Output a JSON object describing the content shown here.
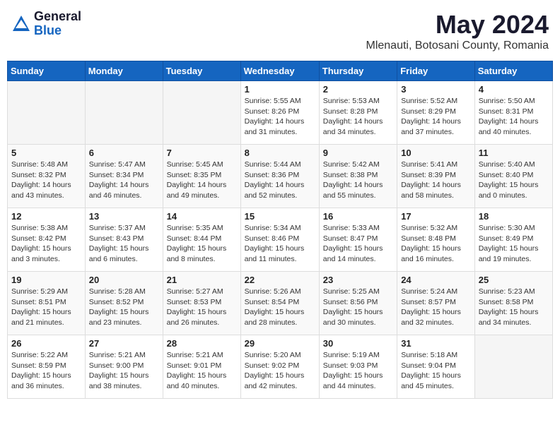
{
  "logo": {
    "general": "General",
    "blue": "Blue"
  },
  "header": {
    "month_year": "May 2024",
    "location": "Mlenauti, Botosani County, Romania"
  },
  "days_of_week": [
    "Sunday",
    "Monday",
    "Tuesday",
    "Wednesday",
    "Thursday",
    "Friday",
    "Saturday"
  ],
  "weeks": [
    [
      {
        "day": "",
        "sunrise": "",
        "sunset": "",
        "daylight": ""
      },
      {
        "day": "",
        "sunrise": "",
        "sunset": "",
        "daylight": ""
      },
      {
        "day": "",
        "sunrise": "",
        "sunset": "",
        "daylight": ""
      },
      {
        "day": "1",
        "sunrise": "Sunrise: 5:55 AM",
        "sunset": "Sunset: 8:26 PM",
        "daylight": "Daylight: 14 hours and 31 minutes."
      },
      {
        "day": "2",
        "sunrise": "Sunrise: 5:53 AM",
        "sunset": "Sunset: 8:28 PM",
        "daylight": "Daylight: 14 hours and 34 minutes."
      },
      {
        "day": "3",
        "sunrise": "Sunrise: 5:52 AM",
        "sunset": "Sunset: 8:29 PM",
        "daylight": "Daylight: 14 hours and 37 minutes."
      },
      {
        "day": "4",
        "sunrise": "Sunrise: 5:50 AM",
        "sunset": "Sunset: 8:31 PM",
        "daylight": "Daylight: 14 hours and 40 minutes."
      }
    ],
    [
      {
        "day": "5",
        "sunrise": "Sunrise: 5:48 AM",
        "sunset": "Sunset: 8:32 PM",
        "daylight": "Daylight: 14 hours and 43 minutes."
      },
      {
        "day": "6",
        "sunrise": "Sunrise: 5:47 AM",
        "sunset": "Sunset: 8:34 PM",
        "daylight": "Daylight: 14 hours and 46 minutes."
      },
      {
        "day": "7",
        "sunrise": "Sunrise: 5:45 AM",
        "sunset": "Sunset: 8:35 PM",
        "daylight": "Daylight: 14 hours and 49 minutes."
      },
      {
        "day": "8",
        "sunrise": "Sunrise: 5:44 AM",
        "sunset": "Sunset: 8:36 PM",
        "daylight": "Daylight: 14 hours and 52 minutes."
      },
      {
        "day": "9",
        "sunrise": "Sunrise: 5:42 AM",
        "sunset": "Sunset: 8:38 PM",
        "daylight": "Daylight: 14 hours and 55 minutes."
      },
      {
        "day": "10",
        "sunrise": "Sunrise: 5:41 AM",
        "sunset": "Sunset: 8:39 PM",
        "daylight": "Daylight: 14 hours and 58 minutes."
      },
      {
        "day": "11",
        "sunrise": "Sunrise: 5:40 AM",
        "sunset": "Sunset: 8:40 PM",
        "daylight": "Daylight: 15 hours and 0 minutes."
      }
    ],
    [
      {
        "day": "12",
        "sunrise": "Sunrise: 5:38 AM",
        "sunset": "Sunset: 8:42 PM",
        "daylight": "Daylight: 15 hours and 3 minutes."
      },
      {
        "day": "13",
        "sunrise": "Sunrise: 5:37 AM",
        "sunset": "Sunset: 8:43 PM",
        "daylight": "Daylight: 15 hours and 6 minutes."
      },
      {
        "day": "14",
        "sunrise": "Sunrise: 5:35 AM",
        "sunset": "Sunset: 8:44 PM",
        "daylight": "Daylight: 15 hours and 8 minutes."
      },
      {
        "day": "15",
        "sunrise": "Sunrise: 5:34 AM",
        "sunset": "Sunset: 8:46 PM",
        "daylight": "Daylight: 15 hours and 11 minutes."
      },
      {
        "day": "16",
        "sunrise": "Sunrise: 5:33 AM",
        "sunset": "Sunset: 8:47 PM",
        "daylight": "Daylight: 15 hours and 14 minutes."
      },
      {
        "day": "17",
        "sunrise": "Sunrise: 5:32 AM",
        "sunset": "Sunset: 8:48 PM",
        "daylight": "Daylight: 15 hours and 16 minutes."
      },
      {
        "day": "18",
        "sunrise": "Sunrise: 5:30 AM",
        "sunset": "Sunset: 8:49 PM",
        "daylight": "Daylight: 15 hours and 19 minutes."
      }
    ],
    [
      {
        "day": "19",
        "sunrise": "Sunrise: 5:29 AM",
        "sunset": "Sunset: 8:51 PM",
        "daylight": "Daylight: 15 hours and 21 minutes."
      },
      {
        "day": "20",
        "sunrise": "Sunrise: 5:28 AM",
        "sunset": "Sunset: 8:52 PM",
        "daylight": "Daylight: 15 hours and 23 minutes."
      },
      {
        "day": "21",
        "sunrise": "Sunrise: 5:27 AM",
        "sunset": "Sunset: 8:53 PM",
        "daylight": "Daylight: 15 hours and 26 minutes."
      },
      {
        "day": "22",
        "sunrise": "Sunrise: 5:26 AM",
        "sunset": "Sunset: 8:54 PM",
        "daylight": "Daylight: 15 hours and 28 minutes."
      },
      {
        "day": "23",
        "sunrise": "Sunrise: 5:25 AM",
        "sunset": "Sunset: 8:56 PM",
        "daylight": "Daylight: 15 hours and 30 minutes."
      },
      {
        "day": "24",
        "sunrise": "Sunrise: 5:24 AM",
        "sunset": "Sunset: 8:57 PM",
        "daylight": "Daylight: 15 hours and 32 minutes."
      },
      {
        "day": "25",
        "sunrise": "Sunrise: 5:23 AM",
        "sunset": "Sunset: 8:58 PM",
        "daylight": "Daylight: 15 hours and 34 minutes."
      }
    ],
    [
      {
        "day": "26",
        "sunrise": "Sunrise: 5:22 AM",
        "sunset": "Sunset: 8:59 PM",
        "daylight": "Daylight: 15 hours and 36 minutes."
      },
      {
        "day": "27",
        "sunrise": "Sunrise: 5:21 AM",
        "sunset": "Sunset: 9:00 PM",
        "daylight": "Daylight: 15 hours and 38 minutes."
      },
      {
        "day": "28",
        "sunrise": "Sunrise: 5:21 AM",
        "sunset": "Sunset: 9:01 PM",
        "daylight": "Daylight: 15 hours and 40 minutes."
      },
      {
        "day": "29",
        "sunrise": "Sunrise: 5:20 AM",
        "sunset": "Sunset: 9:02 PM",
        "daylight": "Daylight: 15 hours and 42 minutes."
      },
      {
        "day": "30",
        "sunrise": "Sunrise: 5:19 AM",
        "sunset": "Sunset: 9:03 PM",
        "daylight": "Daylight: 15 hours and 44 minutes."
      },
      {
        "day": "31",
        "sunrise": "Sunrise: 5:18 AM",
        "sunset": "Sunset: 9:04 PM",
        "daylight": "Daylight: 15 hours and 45 minutes."
      },
      {
        "day": "",
        "sunrise": "",
        "sunset": "",
        "daylight": ""
      }
    ]
  ]
}
